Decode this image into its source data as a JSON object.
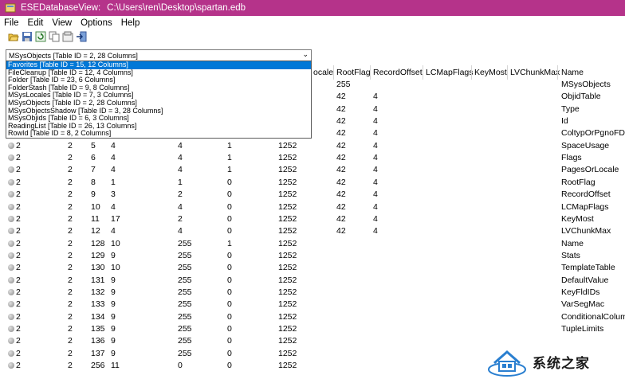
{
  "window": {
    "app_name": "ESEDatabaseView:",
    "file_path": "C:\\Users\\ren\\Desktop\\spartan.edb"
  },
  "menu": [
    "File",
    "Edit",
    "View",
    "Options",
    "Help"
  ],
  "toolbar": [
    "open-icon",
    "save-icon",
    "refresh-icon",
    "copy-icon",
    "properties-icon",
    "exit-icon"
  ],
  "table_selector": {
    "value": "MSysObjects   [Table ID = 2, 28 Columns]",
    "options": [
      {
        "label": "Favorites   [Table ID = 15, 12 Columns]",
        "selected": true
      },
      {
        "label": "FileCleanup   [Table ID = 12, 4 Columns]",
        "selected": false
      },
      {
        "label": "Folder   [Table ID = 23, 6 Columns]",
        "selected": false
      },
      {
        "label": "FolderStash   [Table ID = 9, 8 Columns]",
        "selected": false
      },
      {
        "label": "MSysLocales   [Table ID = 7, 3 Columns]",
        "selected": false
      },
      {
        "label": "MSysObjects   [Table ID = 2, 28 Columns]",
        "selected": false
      },
      {
        "label": "MSysObjectsShadow   [Table ID = 3, 28 Columns]",
        "selected": false
      },
      {
        "label": "MSysObjids   [Table ID = 6, 3 Columns]",
        "selected": false
      },
      {
        "label": "ReadingList   [Table ID = 26, 13 Columns]",
        "selected": false
      },
      {
        "label": "RowId   [Table ID = 8, 2 Columns]",
        "selected": false
      }
    ]
  },
  "columns": [
    "ocale",
    "RootFlag",
    "RecordOffset",
    "LCMapFlags",
    "KeyMost",
    "LVChunkMax",
    "Name"
  ],
  "rows": [
    {
      "c1": "",
      "c2": "",
      "c3": "",
      "c4": "",
      "c5": "",
      "c6": "",
      "c7": "",
      "rootflag": "255",
      "recoff": "",
      "name": "MSysObjects"
    },
    {
      "c1": "",
      "c2": "",
      "c3": "",
      "c4": "",
      "c5": "",
      "c6": "",
      "c7": "",
      "rootflag": "42",
      "recoff": "4",
      "name": "ObjidTable"
    },
    {
      "c1": "",
      "c2": "",
      "c3": "",
      "c4": "",
      "c5": "",
      "c6": "",
      "c7": "",
      "rootflag": "42",
      "recoff": "4",
      "name": "Type"
    },
    {
      "c1": "",
      "c2": "",
      "c3": "",
      "c4": "",
      "c5": "",
      "c6": "",
      "c7": "",
      "rootflag": "42",
      "recoff": "4",
      "name": "Id"
    },
    {
      "c1": "",
      "c2": "",
      "c3": "",
      "c4": "",
      "c5": "",
      "c6": "",
      "c7": "",
      "rootflag": "42",
      "recoff": "4",
      "name": "ColtypOrPgnoFDP"
    },
    {
      "c1": "2",
      "c2": "2",
      "c3": "5",
      "c4": "4",
      "c5": "4",
      "c6": "1",
      "c7": "1252",
      "rootflag": "42",
      "recoff": "4",
      "name": "SpaceUsage"
    },
    {
      "c1": "2",
      "c2": "2",
      "c3": "6",
      "c4": "4",
      "c5": "4",
      "c6": "1",
      "c7": "1252",
      "rootflag": "42",
      "recoff": "4",
      "name": "Flags"
    },
    {
      "c1": "2",
      "c2": "2",
      "c3": "7",
      "c4": "4",
      "c5": "4",
      "c6": "1",
      "c7": "1252",
      "rootflag": "42",
      "recoff": "4",
      "name": "PagesOrLocale"
    },
    {
      "c1": "2",
      "c2": "2",
      "c3": "8",
      "c4": "1",
      "c5": "1",
      "c6": "0",
      "c7": "1252",
      "rootflag": "42",
      "recoff": "4",
      "name": "RootFlag"
    },
    {
      "c1": "2",
      "c2": "2",
      "c3": "9",
      "c4": "3",
      "c5": "2",
      "c6": "0",
      "c7": "1252",
      "rootflag": "42",
      "recoff": "4",
      "name": "RecordOffset"
    },
    {
      "c1": "2",
      "c2": "2",
      "c3": "10",
      "c4": "4",
      "c5": "4",
      "c6": "0",
      "c7": "1252",
      "rootflag": "42",
      "recoff": "4",
      "name": "LCMapFlags"
    },
    {
      "c1": "2",
      "c2": "2",
      "c3": "11",
      "c4": "17",
      "c5": "2",
      "c6": "0",
      "c7": "1252",
      "rootflag": "42",
      "recoff": "4",
      "name": "KeyMost"
    },
    {
      "c1": "2",
      "c2": "2",
      "c3": "12",
      "c4": "4",
      "c5": "4",
      "c6": "0",
      "c7": "1252",
      "rootflag": "42",
      "recoff": "4",
      "name": "LVChunkMax"
    },
    {
      "c1": "2",
      "c2": "2",
      "c3": "128",
      "c4": "10",
      "c5": "255",
      "c6": "1",
      "c7": "1252",
      "rootflag": "",
      "recoff": "",
      "name": "Name"
    },
    {
      "c1": "2",
      "c2": "2",
      "c3": "129",
      "c4": "9",
      "c5": "255",
      "c6": "0",
      "c7": "1252",
      "rootflag": "",
      "recoff": "",
      "name": "Stats"
    },
    {
      "c1": "2",
      "c2": "2",
      "c3": "130",
      "c4": "10",
      "c5": "255",
      "c6": "0",
      "c7": "1252",
      "rootflag": "",
      "recoff": "",
      "name": "TemplateTable"
    },
    {
      "c1": "2",
      "c2": "2",
      "c3": "131",
      "c4": "9",
      "c5": "255",
      "c6": "0",
      "c7": "1252",
      "rootflag": "",
      "recoff": "",
      "name": "DefaultValue"
    },
    {
      "c1": "2",
      "c2": "2",
      "c3": "132",
      "c4": "9",
      "c5": "255",
      "c6": "0",
      "c7": "1252",
      "rootflag": "",
      "recoff": "",
      "name": "KeyFldIDs"
    },
    {
      "c1": "2",
      "c2": "2",
      "c3": "133",
      "c4": "9",
      "c5": "255",
      "c6": "0",
      "c7": "1252",
      "rootflag": "",
      "recoff": "",
      "name": "VarSegMac"
    },
    {
      "c1": "2",
      "c2": "2",
      "c3": "134",
      "c4": "9",
      "c5": "255",
      "c6": "0",
      "c7": "1252",
      "rootflag": "",
      "recoff": "",
      "name": "ConditionalColumn"
    },
    {
      "c1": "2",
      "c2": "2",
      "c3": "135",
      "c4": "9",
      "c5": "255",
      "c6": "0",
      "c7": "1252",
      "rootflag": "",
      "recoff": "",
      "name": "TupleLimits"
    },
    {
      "c1": "2",
      "c2": "2",
      "c3": "136",
      "c4": "9",
      "c5": "255",
      "c6": "0",
      "c7": "1252",
      "rootflag": "",
      "recoff": "",
      "name": ""
    },
    {
      "c1": "2",
      "c2": "2",
      "c3": "137",
      "c4": "9",
      "c5": "255",
      "c6": "0",
      "c7": "1252",
      "rootflag": "",
      "recoff": "",
      "name": ""
    },
    {
      "c1": "2",
      "c2": "2",
      "c3": "256",
      "c4": "11",
      "c5": "0",
      "c6": "0",
      "c7": "1252",
      "rootflag": "",
      "recoff": "",
      "name": ""
    }
  ],
  "watermark": {
    "text": "系统之家"
  },
  "colors": {
    "titlebar": "#b5338a",
    "selection": "#0078d7"
  }
}
